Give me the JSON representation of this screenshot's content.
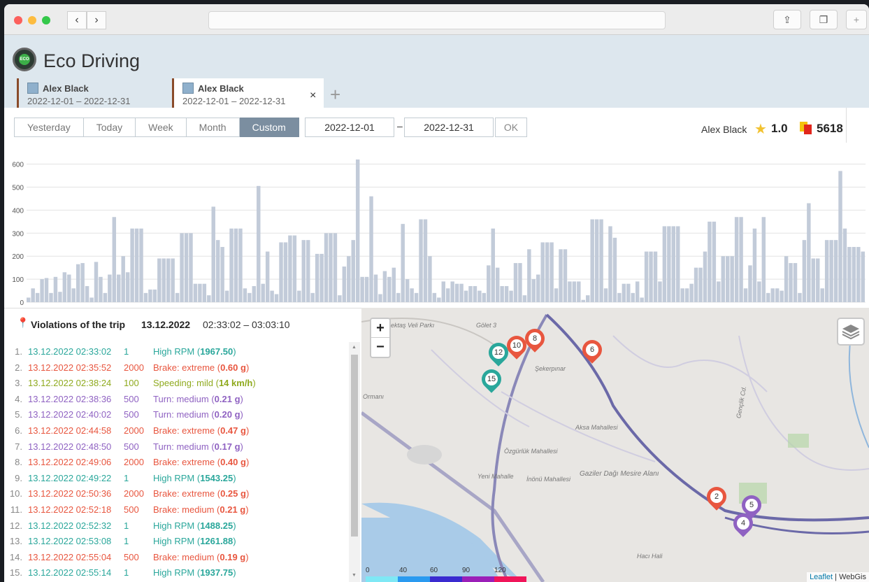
{
  "browser": {
    "back_icon": "chevron-left-icon",
    "forward_icon": "chevron-right-icon",
    "share_icon": "share-icon",
    "tabs_icon": "tabs-icon",
    "new_tab_icon": "plus-icon"
  },
  "app": {
    "title": "Eco Driving",
    "logo_text": "ECO"
  },
  "tabs": [
    {
      "name": "Alex Black",
      "dates": "2022-12-01  –  2022-12-31"
    },
    {
      "name": "Alex Black",
      "dates": "2022-12-01  –  2022-12-31"
    }
  ],
  "tab_close": "×",
  "tab_add": "+",
  "periods": [
    "Yesterday",
    "Today",
    "Week",
    "Month",
    "Custom"
  ],
  "active_period": "Custom",
  "date_from": "2022-12-01",
  "date_separator": "–",
  "date_to": "2022-12-31",
  "ok_label": "OK",
  "driver": {
    "name": "Alex Black",
    "rating": "1.0",
    "score": "5618"
  },
  "chart_data": {
    "type": "bar",
    "ylim": [
      0,
      620
    ],
    "yticks": [
      "0",
      "100",
      "200",
      "300",
      "400",
      "500",
      "600"
    ],
    "values": [
      20,
      60,
      40,
      100,
      105,
      40,
      110,
      45,
      130,
      120,
      60,
      165,
      170,
      70,
      20,
      175,
      110,
      40,
      120,
      370,
      120,
      200,
      130,
      320,
      320,
      320,
      40,
      55,
      55,
      190,
      190,
      190,
      190,
      40,
      300,
      300,
      300,
      80,
      80,
      80,
      30,
      415,
      270,
      240,
      50,
      320,
      320,
      320,
      60,
      40,
      70,
      505,
      80,
      220,
      50,
      35,
      260,
      260,
      290,
      290,
      50,
      270,
      270,
      40,
      210,
      210,
      300,
      300,
      300,
      30,
      155,
      200,
      270,
      620,
      110,
      110,
      460,
      120,
      35,
      135,
      110,
      150,
      40,
      340,
      100,
      60,
      40,
      360,
      360,
      200,
      40,
      20,
      90,
      60,
      90,
      80,
      80,
      50,
      70,
      70,
      50,
      40,
      160,
      320,
      150,
      70,
      70,
      50,
      170,
      170,
      30,
      230,
      100,
      120,
      260,
      260,
      260,
      60,
      230,
      230,
      90,
      90,
      90,
      10,
      30,
      360,
      360,
      360,
      60,
      330,
      280,
      40,
      80,
      80,
      40,
      90,
      20,
      220,
      220,
      220,
      90,
      330,
      330,
      330,
      330,
      60,
      60,
      80,
      150,
      150,
      220,
      350,
      350,
      90,
      200,
      200,
      200,
      370,
      370,
      60,
      160,
      320,
      90,
      370,
      40,
      60,
      60,
      50,
      200,
      170,
      170,
      40,
      270,
      430,
      190,
      190,
      60,
      270,
      270,
      270,
      570,
      320,
      240,
      240,
      240,
      220
    ]
  },
  "violations": {
    "title": "Violations of the trip",
    "date": "13.12.2022",
    "range": "02:33:02 – 03:03:10",
    "rows": [
      {
        "num": "1.",
        "time": "13.12.2022 02:33:02",
        "val": "1",
        "label": "High RPM (",
        "amount": "1967.50",
        "close": ")",
        "color": "teal"
      },
      {
        "num": "2.",
        "time": "13.12.2022 02:35:52",
        "val": "2000",
        "label": "Brake: extreme (",
        "amount": "0.60 g",
        "close": ")",
        "color": "red"
      },
      {
        "num": "3.",
        "time": "13.12.2022 02:38:24",
        "val": "100",
        "label": "Speeding: mild (",
        "amount": "14 km/h",
        "close": ")",
        "color": "olive"
      },
      {
        "num": "4.",
        "time": "13.12.2022 02:38:36",
        "val": "500",
        "label": "Turn: medium (",
        "amount": "0.21 g",
        "close": ")",
        "color": "purple"
      },
      {
        "num": "5.",
        "time": "13.12.2022 02:40:02",
        "val": "500",
        "label": "Turn: medium (",
        "amount": "0.20 g",
        "close": ")",
        "color": "purple"
      },
      {
        "num": "6.",
        "time": "13.12.2022 02:44:58",
        "val": "2000",
        "label": "Brake: extreme (",
        "amount": "0.47 g",
        "close": ")",
        "color": "red"
      },
      {
        "num": "7.",
        "time": "13.12.2022 02:48:50",
        "val": "500",
        "label": "Turn: medium (",
        "amount": "0.17 g",
        "close": ")",
        "color": "purple"
      },
      {
        "num": "8.",
        "time": "13.12.2022 02:49:06",
        "val": "2000",
        "label": "Brake: extreme (",
        "amount": "0.40 g",
        "close": ")",
        "color": "red"
      },
      {
        "num": "9.",
        "time": "13.12.2022 02:49:22",
        "val": "1",
        "label": "High RPM (",
        "amount": "1543.25",
        "close": ")",
        "color": "teal"
      },
      {
        "num": "10.",
        "time": "13.12.2022 02:50:36",
        "val": "2000",
        "label": "Brake: extreme (",
        "amount": "0.25 g",
        "close": ")",
        "color": "red"
      },
      {
        "num": "11.",
        "time": "13.12.2022 02:52:18",
        "val": "500",
        "label": "Brake: medium (",
        "amount": "0.21 g",
        "close": ")",
        "color": "red"
      },
      {
        "num": "12.",
        "time": "13.12.2022 02:52:32",
        "val": "1",
        "label": "High RPM (",
        "amount": "1488.25",
        "close": ")",
        "color": "teal"
      },
      {
        "num": "13.",
        "time": "13.12.2022 02:53:08",
        "val": "1",
        "label": "High RPM (",
        "amount": "1261.88",
        "close": ")",
        "color": "teal"
      },
      {
        "num": "14.",
        "time": "13.12.2022 02:55:04",
        "val": "500",
        "label": "Brake: medium (",
        "amount": "0.19 g",
        "close": ")",
        "color": "red"
      },
      {
        "num": "15.",
        "time": "13.12.2022 02:55:14",
        "val": "1",
        "label": "High RPM (",
        "amount": "1937.75",
        "close": ")",
        "color": "teal"
      }
    ]
  },
  "map": {
    "zoom_in": "+",
    "zoom_out": "−",
    "layers_icon": "layers-icon",
    "attribution_link": "Leaflet",
    "attribution_sep": " | ",
    "attribution_rest": "WebGis",
    "labels": [
      "Ormanı",
      "ektaş Veli Parkı",
      "Gölet 3",
      "Şekerpınar",
      "Aksa Mahallesi",
      "Özgürlük Mahallesi",
      "Gaziler Dağı Mesire Alanı",
      "Yeni Mahalle",
      "İnönü Mahallesi",
      "Gençlik Cd.",
      "Hacı Hali"
    ],
    "speed_scale": [
      "0",
      "40",
      "60",
      "90",
      "120"
    ],
    "markers": [
      {
        "label": "15",
        "color": "#2aa79b"
      },
      {
        "label": "12",
        "color": "#2aa79b"
      },
      {
        "label": "10",
        "color": "#e8563f"
      },
      {
        "label": "8",
        "color": "#e8563f"
      },
      {
        "label": "6",
        "color": "#e8563f"
      },
      {
        "label": "2",
        "color": "#e8563f"
      },
      {
        "label": "5",
        "color": "#8f62c2"
      },
      {
        "label": "4",
        "color": "#8f62c2"
      }
    ]
  },
  "colors": {
    "teal": "#2aa79b",
    "red": "#e8563f",
    "olive": "#8faa1e",
    "purple": "#8f62c2",
    "bar": "#c2cbd9"
  }
}
